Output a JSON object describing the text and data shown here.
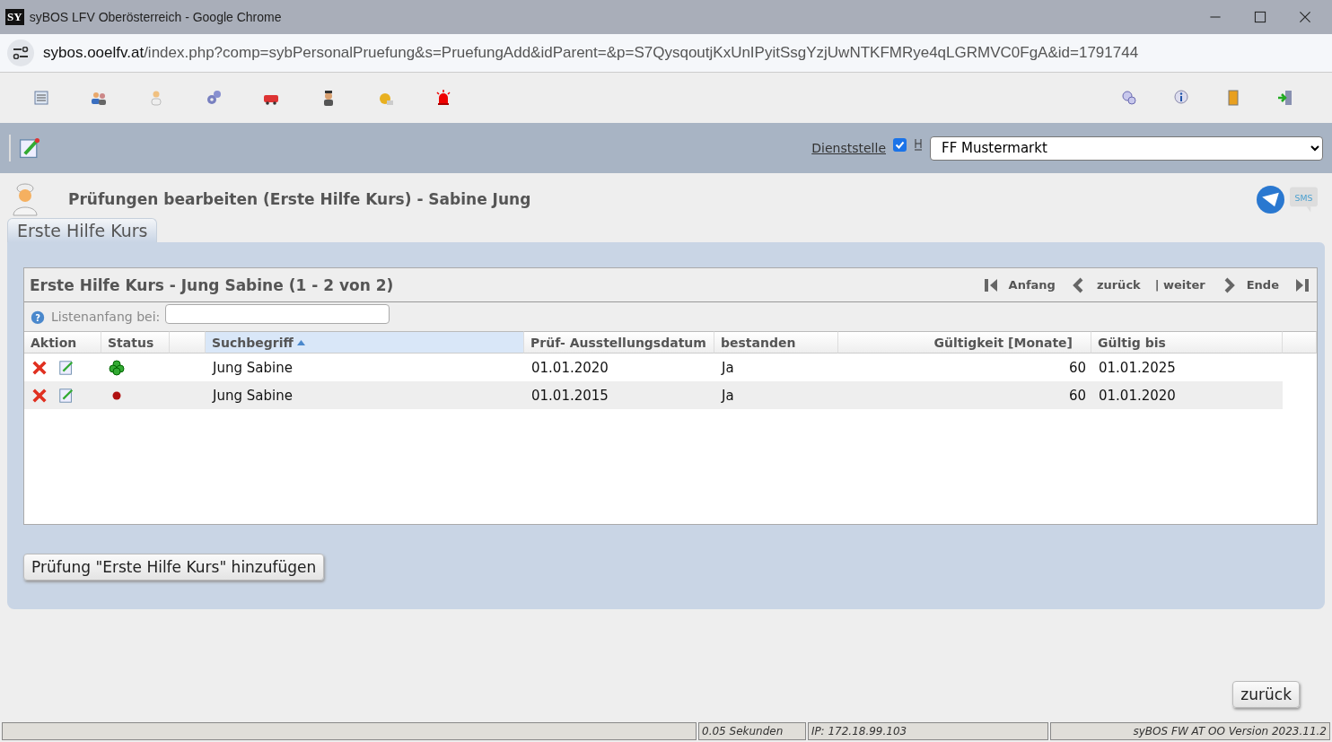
{
  "window": {
    "logo": "SY",
    "title": "syBOS LFV Oberösterreich - Google Chrome",
    "url_host": "sybos.ooelfv.at",
    "url_path": "/index.php?comp=sybPersonalPruefung&s=PruefungAdd&idParent=&p=S7QysqoutjKxUnIPyitSsgYzjUwNTKFMRye4qLGRMVC0FgA&id=1791744"
  },
  "toolbar": {
    "dienststelle_label": "Dienststelle",
    "dienststelle_checked": true,
    "dienststelle_value": "FF Mustermarkt"
  },
  "page": {
    "heading": "Prüfungen bearbeiten (Erste Hilfe Kurs) - Sabine Jung",
    "sms_label": "SMS"
  },
  "tabs": [
    {
      "label": "Erste Hilfe Kurs",
      "selected": true
    }
  ],
  "list": {
    "title": "Erste Hilfe Kurs - Jung Sabine (1 - 2 von 2)",
    "nav": [
      "Anfang",
      "zurück",
      "| weiter",
      "Ende"
    ],
    "help_glyph": "?",
    "filter_label": "Listenanfang bei:",
    "columns": [
      {
        "label": "Aktion",
        "sorted": false
      },
      {
        "label": "Status",
        "sorted": false
      },
      {
        "label": "Suchbegriff",
        "sorted": true
      },
      {
        "label": "Prüf- Ausstellungsdatum",
        "sorted": false
      },
      {
        "label": "bestanden",
        "sorted": false
      },
      {
        "label": "Gültigkeit [Monate]",
        "sorted": false
      },
      {
        "label": "Gültig bis",
        "sorted": false
      }
    ],
    "rows": [
      {
        "kind": "valid",
        "name": "Jung Sabine",
        "date": "01.01.2020",
        "passed": "Ja",
        "months": "60",
        "valid_until": "01.01.2025"
      },
      {
        "kind": "expired",
        "name": "Jung Sabine",
        "date": "01.01.2015",
        "passed": "Ja",
        "months": "60",
        "valid_until": "01.01.2020"
      }
    ]
  },
  "add_button": "Prüfung \"Erste Hilfe Kurs\" hinzufügen",
  "back_button": "zurück",
  "status_bar": {
    "timing": "0.05 Sekunden",
    "ip": "IP: 172.18.99.103",
    "version": "syBOS FW AT OO Version 2023.11.2"
  }
}
